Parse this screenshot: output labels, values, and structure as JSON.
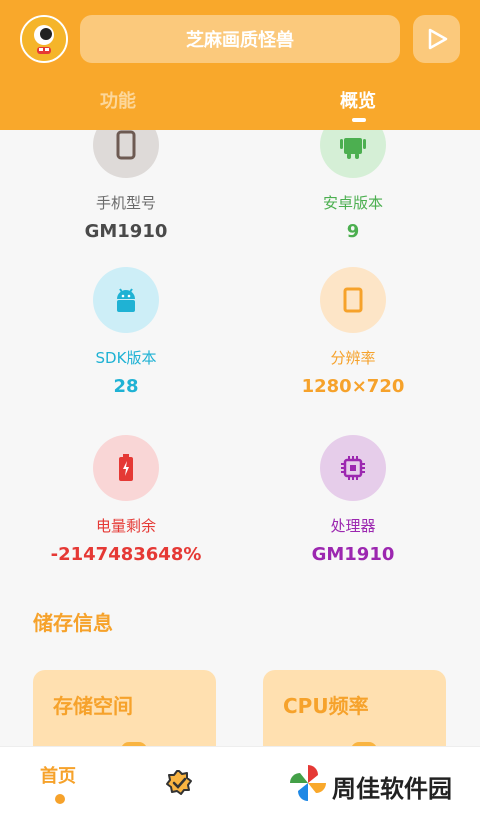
{
  "header": {
    "title": "芝麻画质怪兽",
    "tabs": [
      {
        "label": "功能",
        "active": false
      },
      {
        "label": "概览",
        "active": true
      }
    ]
  },
  "info_items": [
    {
      "label": "手机型号",
      "value": "GM1910",
      "icon": "phone-icon",
      "circle_color": "#dedad8",
      "label_color": "#6b6b6b",
      "value_color": "#4a4a4a"
    },
    {
      "label": "安卓版本",
      "value": "9",
      "icon": "android-icon",
      "circle_color": "#d5efd6",
      "label_color": "#4caf50",
      "value_color": "#4caf50"
    },
    {
      "label": "SDK版本",
      "value": "28",
      "icon": "android-head-icon",
      "circle_color": "#cdeef7",
      "label_color": "#1fb2d4",
      "value_color": "#1fb2d4"
    },
    {
      "label": "分辨率",
      "value": "1280×720",
      "icon": "screen-icon",
      "circle_color": "#fde5c7",
      "label_color": "#f6a22b",
      "value_color": "#f6a22b"
    },
    {
      "label": "电量剩余",
      "value": "-2147483648%",
      "icon": "battery-icon",
      "circle_color": "#f9d6d6",
      "label_color": "#e53935",
      "value_color": "#e53935"
    },
    {
      "label": "处理器",
      "value": "GM1910",
      "icon": "cpu-icon",
      "circle_color": "#e6cdea",
      "label_color": "#9c27b0",
      "value_color": "#9c27b0"
    }
  ],
  "storage": {
    "section_title": "储存信息",
    "cards": [
      {
        "title": "存储空间"
      },
      {
        "title": "CPU频率"
      }
    ]
  },
  "bottom_nav": {
    "home_label": "首页"
  },
  "watermark": {
    "text": "周佳软件园"
  }
}
